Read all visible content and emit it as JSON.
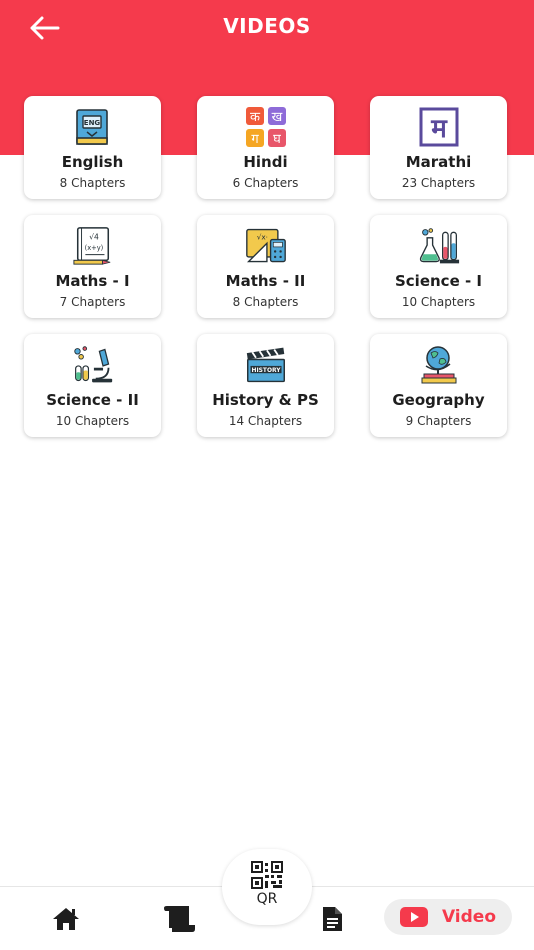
{
  "header": {
    "title": "VIDEOS"
  },
  "subjects": [
    {
      "name": "English",
      "chapters": "8 Chapters",
      "icon": "book-icon"
    },
    {
      "name": "Hindi",
      "chapters": "6 Chapters",
      "icon": "devanagari-letters-icon",
      "letters": [
        "क",
        "ख",
        "ग",
        "घ"
      ]
    },
    {
      "name": "Marathi",
      "chapters": "23 Chapters",
      "icon": "marathi-letter-icon",
      "letter": "म"
    },
    {
      "name": "Maths - I",
      "chapters": "7 Chapters",
      "icon": "math-notes-icon"
    },
    {
      "name": "Maths - II",
      "chapters": "8 Chapters",
      "icon": "geometry-tools-icon"
    },
    {
      "name": "Science - I",
      "chapters": "10 Chapters",
      "icon": "lab-flask-icon"
    },
    {
      "name": "Science - II",
      "chapters": "10 Chapters",
      "icon": "microscope-icon"
    },
    {
      "name": "History & PS",
      "chapters": "14 Chapters",
      "icon": "clapperboard-icon"
    },
    {
      "name": "Geography",
      "chapters": "9 Chapters",
      "icon": "globe-icon"
    }
  ],
  "bottom_nav": {
    "qr_label": "QR",
    "video_label": "Video"
  },
  "colors": {
    "accent": "#f53a4c",
    "card_bg": "#ffffff",
    "pill_bg": "#eeeeee"
  }
}
